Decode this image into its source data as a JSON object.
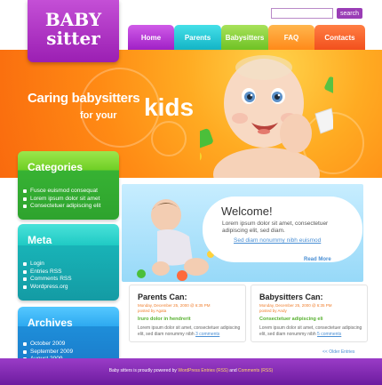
{
  "logo": {
    "line1": "BABY",
    "line2": "sitter"
  },
  "search": {
    "placeholder": "",
    "button_label": "search"
  },
  "nav": [
    "Home",
    "Parents",
    "Babysitters",
    "FAQ",
    "Contacts"
  ],
  "hero": {
    "line1": "Caring babysitters",
    "line2": "for your",
    "kids": "kids"
  },
  "sidebar": {
    "categories": {
      "title": "Categories",
      "items": [
        "Fusce euismod consequat",
        "Lorem ipsum dolor sit amet",
        "Consectetuer adipiscing elit"
      ]
    },
    "meta": {
      "title": "Meta",
      "items": [
        "Login",
        "Entries RSS",
        "Comments RSS",
        "Wordpress.org"
      ]
    },
    "archives": {
      "title": "Archives",
      "items": [
        "October 2009",
        "September 2009",
        "August 2009"
      ]
    }
  },
  "welcome": {
    "title": "Welcome!",
    "text": "Lorem ipsum dolor sit amet, consectetuer adipiscing elit, sed diam.",
    "link": "Sed diam nonummy nibh euismod",
    "read_more": "Read More"
  },
  "posts": [
    {
      "title": "Parents Can:",
      "meta1": "Monday, December 25, 2000 @ 6:35 PM",
      "meta2": "posted by Agata",
      "subtitle": "Iruro dolor in hendrerit",
      "text": "Lorem ipsum dolor sit amet, consectetuer adipiscing elit, sed diam nonummy nibh",
      "comments": "3 comments"
    },
    {
      "title": "Babysitters Can:",
      "meta1": "Monday, December 25, 2000 @ 6:35 PM",
      "meta2": "posted by Andy",
      "subtitle": "Consectetuer adipiscing eli",
      "text": "Lorem ipsum dolor sit amet, consectetuer adipiscing elit, sed diam nonummy nibh",
      "comments": "5 comments"
    }
  ],
  "older_entries": "<< Older Entries",
  "footer": {
    "pre": "Baby sitters is proudly powered by",
    "wp": "WordPress Entries (RSS)",
    "and": "and",
    "comments": "Comments (RSS)"
  },
  "colors": {
    "purple": "#9b1fb3",
    "orange": "#ff8a14",
    "green": "#6fcf25",
    "teal": "#1fcac4",
    "blue": "#2da9f0"
  }
}
